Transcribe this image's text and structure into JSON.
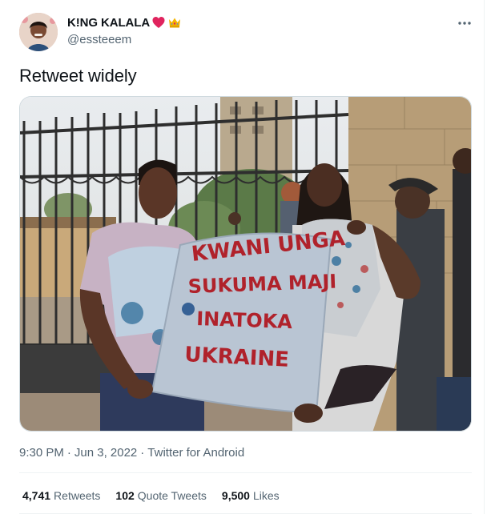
{
  "tweet": {
    "author": {
      "display_name": "K!NG KALALA",
      "handle": "@essteeem",
      "emojis": [
        "heart-emoji",
        "crown-emoji"
      ]
    },
    "text": "Retweet widely",
    "media": {
      "sign_lines": [
        "KWANI UNGA",
        "SUKUMA MAJI",
        "INATOKA",
        "UKRAINE"
      ]
    },
    "meta": {
      "time": "9:30 PM",
      "date": "Jun 3, 2022",
      "source": "Twitter for Android",
      "separator": "·"
    },
    "stats": {
      "retweets": {
        "count": "4,741",
        "label": "Retweets"
      },
      "quotes": {
        "count": "102",
        "label": "Quote Tweets"
      },
      "likes": {
        "count": "9,500",
        "label": "Likes"
      }
    }
  },
  "colors": {
    "primary_text": "#0f1419",
    "secondary_text": "#536471",
    "divider": "#eff3f4",
    "heart": "#e0245e",
    "sign_ink": "#b0222b"
  },
  "icons": {
    "more": "more-dots-icon"
  }
}
